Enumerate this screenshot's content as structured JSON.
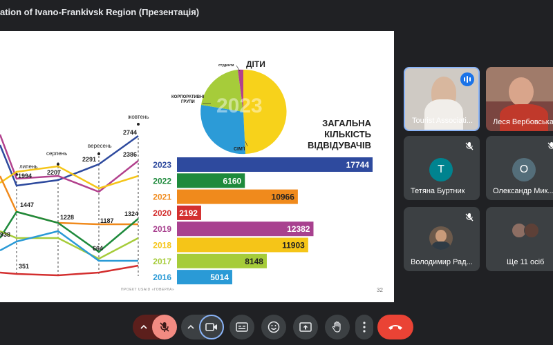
{
  "window": {
    "title": "ation of Ivano-Frankivsk Region (Презентація)"
  },
  "slide": {
    "pie": {
      "year": "2023",
      "labels": {
        "students": "студенти",
        "kids": "ДІТИ",
        "corporate_line1": "КОРПОРАТИВНІ",
        "corporate_line2": "ГРУПИ",
        "family": "СІМ'Ї"
      },
      "colors": {
        "kids": "#f7d21b",
        "family": "#2c9bd7",
        "corporate": "#a6cc3a",
        "students": "#b2418d"
      }
    },
    "bar_heading": [
      "ЗАГАЛЬНА",
      "КІЛЬКІСТЬ",
      "ВІДВІДУВАЧІВ"
    ],
    "line_months": [
      "липень",
      "серпень",
      "вересень",
      "жовтень"
    ],
    "line_labels": [
      "1994",
      "2207",
      "2291",
      "2744",
      "2386",
      "1447",
      "1228",
      "1187",
      "1324",
      "938",
      "664",
      "351"
    ],
    "footer": "ПРОЕКТ USAID «ГОВЕРЛА»",
    "page_number": "32"
  },
  "chart_data": {
    "type": "bar",
    "title": "ЗАГАЛЬНА КІЛЬКІСТЬ ВІДВІДУВАЧІВ",
    "categories": [
      "2023",
      "2022",
      "2021",
      "2020",
      "2019",
      "2018",
      "2017",
      "2016"
    ],
    "values": [
      17744,
      6160,
      10966,
      2192,
      12382,
      11903,
      8148,
      5014
    ],
    "colors": [
      "#2e4a9e",
      "#1e8a3c",
      "#f08a1c",
      "#d32f2f",
      "#a8418f",
      "#f5c518",
      "#a6cc3a",
      "#2a9ad6"
    ]
  },
  "participants": [
    {
      "name": "Tourist Associati...",
      "kind": "video",
      "speaking": true
    },
    {
      "name": "Леся Вербовська",
      "kind": "video"
    },
    {
      "name": "Тетяна Буртник",
      "initial": "T",
      "color": "#00838f",
      "muted": true
    },
    {
      "name": "Олександр Мик...",
      "initial": "О",
      "color": "#546e7a",
      "muted": true
    },
    {
      "name": "Володимир Рад...",
      "kind": "photo",
      "muted": true
    },
    {
      "name": "Ще 11 осіб",
      "kind": "group"
    }
  ],
  "controls": [
    "mic-options",
    "mic-off",
    "camera-options",
    "camera",
    "captions",
    "emoji",
    "present",
    "raise-hand",
    "more",
    "leave-call"
  ]
}
